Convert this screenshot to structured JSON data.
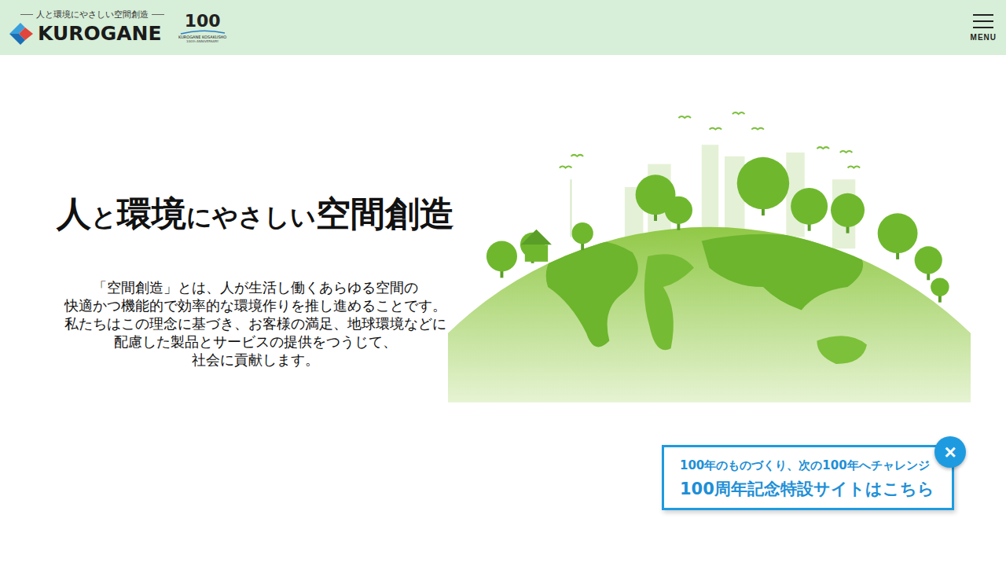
{
  "header": {
    "tagline": "人と環境にやさしい空間創造",
    "logo": "KUROGANE",
    "anniversary": {
      "number": "100",
      "name": "KUROGANE KOSAKUSHO",
      "caption": "100th ANNIVERSARY"
    },
    "menu": {
      "label": "MENU"
    }
  },
  "hero": {
    "heading": [
      {
        "text": "人",
        "kind": "large"
      },
      {
        "text": "と",
        "kind": "small"
      },
      {
        "text": "環境",
        "kind": "large"
      },
      {
        "text": "にやさしい",
        "kind": "small"
      },
      {
        "text": "空間創造",
        "kind": "large"
      }
    ],
    "lines": [
      "「空間創造」とは、人が生活し働くあらゆる空間の",
      "快適かつ機能的で効率的な環境作りを推し進めることです。",
      "私たちはこの理念に基づき、お客様の満足、地球環境などに",
      "配慮した製品とサービスの提供をつうじて、",
      "社会に貢献します。"
    ]
  },
  "banner": {
    "subtitle": "100年のものづくり、次の100年へチャレンジ",
    "title": "100周年記念特設サイトはこちら",
    "close": "×"
  }
}
